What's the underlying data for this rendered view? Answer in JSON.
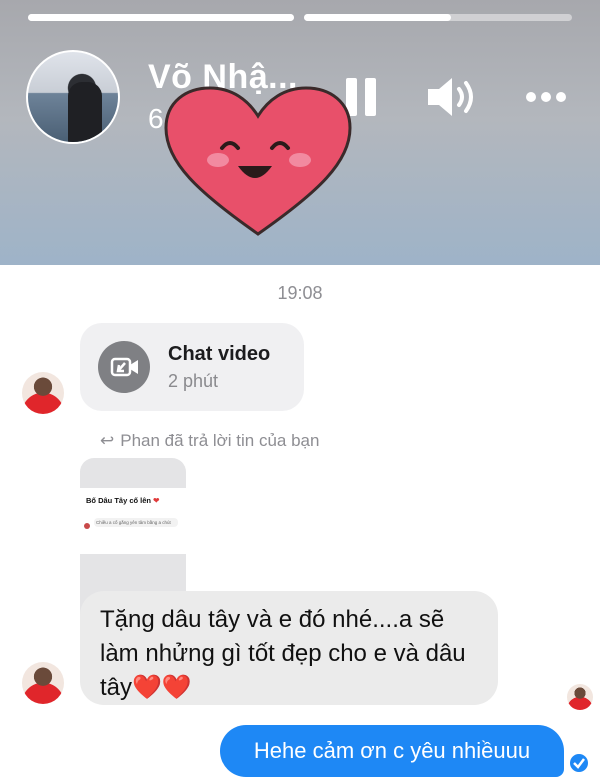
{
  "story": {
    "name": "Võ Nhậ...",
    "time": "6 phút",
    "progress": [
      1.0,
      0.55
    ],
    "icons": [
      "pause-icon",
      "volume-icon",
      "more-icon",
      "heart-sticker"
    ]
  },
  "chat": {
    "timestamp": "19:08",
    "video_call": {
      "title": "Chat video",
      "duration": "2 phút"
    },
    "reply_note": "Phan đã trả lời tin của bạn",
    "reply_preview": {
      "title": "Bố Dâu Tây cố lên",
      "text": "Chiều a cố gắng yên tâm bằng a chút"
    },
    "message": "Tặng dâu tây và e đó nhé....a sẽ làm nhửng gì tốt đẹp cho e và dâu tây",
    "message_emoji": "❤️❤️",
    "sent_message": "Hehe cảm ơn c yêu nhiềuuu"
  },
  "colors": {
    "accent_blue": "#1e88f5",
    "bubble_gray": "#ebebeb",
    "heart_red": "#e8506a"
  }
}
